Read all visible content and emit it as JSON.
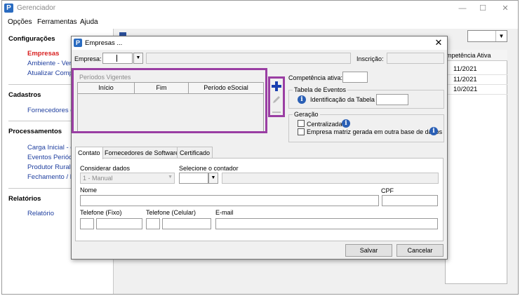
{
  "app": {
    "title": "Gerenciador",
    "icon": "app-logo-icon"
  },
  "menu": [
    {
      "label": "Opções"
    },
    {
      "label": "Ferramentas"
    },
    {
      "label": "Ajuda"
    }
  ],
  "sidebar": {
    "sections": [
      {
        "title": "Configurações",
        "items": [
          {
            "label": "Empresas",
            "active": true
          },
          {
            "label": "Ambiente - Vers"
          },
          {
            "label": "Atualizar Comp"
          }
        ]
      },
      {
        "title": "Cadastros",
        "items": [
          {
            "label": "Fornecedores d"
          }
        ]
      },
      {
        "title": "Processamentos",
        "items": [
          {
            "label": "Carga Inicial - e"
          },
          {
            "label": "Eventos Periódi"
          },
          {
            "label": "Produtor Rural"
          },
          {
            "label": "Fechamento / R"
          }
        ]
      },
      {
        "title": "Relatórios",
        "items": [
          {
            "label": "Relatório"
          }
        ]
      }
    ]
  },
  "background_grid": {
    "column": "mpetência Ativa",
    "rows": [
      "11/2021",
      "11/2021",
      "10/2021"
    ]
  },
  "dialog": {
    "title": "Empresas ...",
    "empresa_label": "Empresa:",
    "inscricao_label": "Inscrição:",
    "periodos": {
      "title": "Períodos Vigentes",
      "columns": [
        "Início",
        "Fim",
        "Período eSocial"
      ]
    },
    "competencia_label": "Competência ativa:",
    "tabela_eventos": {
      "title": "Tabela de Eventos",
      "identificacao_label": "Identificação da Tabela"
    },
    "geracao": {
      "title": "Geração",
      "centralizada_label": "Centralizada",
      "matriz_label": "Empresa matriz gerada em outra base de dados"
    },
    "tabs": [
      "Contato",
      "Fornecedores de Software",
      "Certificado"
    ],
    "contato": {
      "considerar_label": "Considerar dados",
      "considerar_value": "1 - Manual",
      "selecione_label": "Selecione o contador",
      "nome_label": "Nome",
      "cpf_label": "CPF",
      "tel_fixo_label": "Telefone (Fixo)",
      "tel_cel_label": "Telefone (Celular)",
      "email_label": "E-mail"
    },
    "salvar_label": "Salvar",
    "cancelar_label": "Cancelar"
  },
  "colors": {
    "highlight": "#9a3ea3",
    "active_link": "#d81f1f",
    "link": "#1f3f9f",
    "add_icon": "#1a3fb0"
  }
}
